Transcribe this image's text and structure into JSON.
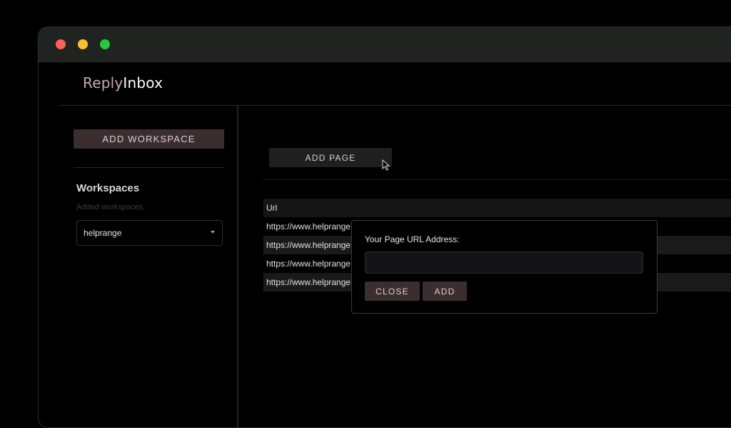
{
  "app": {
    "brand_part1": "Reply",
    "brand_part2": "Inbox"
  },
  "sidebar": {
    "add_workspace_label": "ADD WORKSPACE",
    "workspaces_title": "Workspaces",
    "workspaces_subtitle": "Added workspaces.",
    "selected_workspace": "helprange"
  },
  "main": {
    "add_page_label": "ADD PAGE",
    "table": {
      "header": "Url",
      "rows": [
        "https://www.helprange.",
        "https://www.helprange.",
        "https://www.helprange.",
        "https://www.helprange."
      ]
    }
  },
  "dialog": {
    "label": "Your Page URL Address:",
    "input_value": "",
    "close_label": "CLOSE",
    "add_label": "ADD"
  },
  "colors": {
    "accent_button": "#3a2e30",
    "brand_reply": "#c9a8b0",
    "brand_inbox": "#ffffff"
  }
}
